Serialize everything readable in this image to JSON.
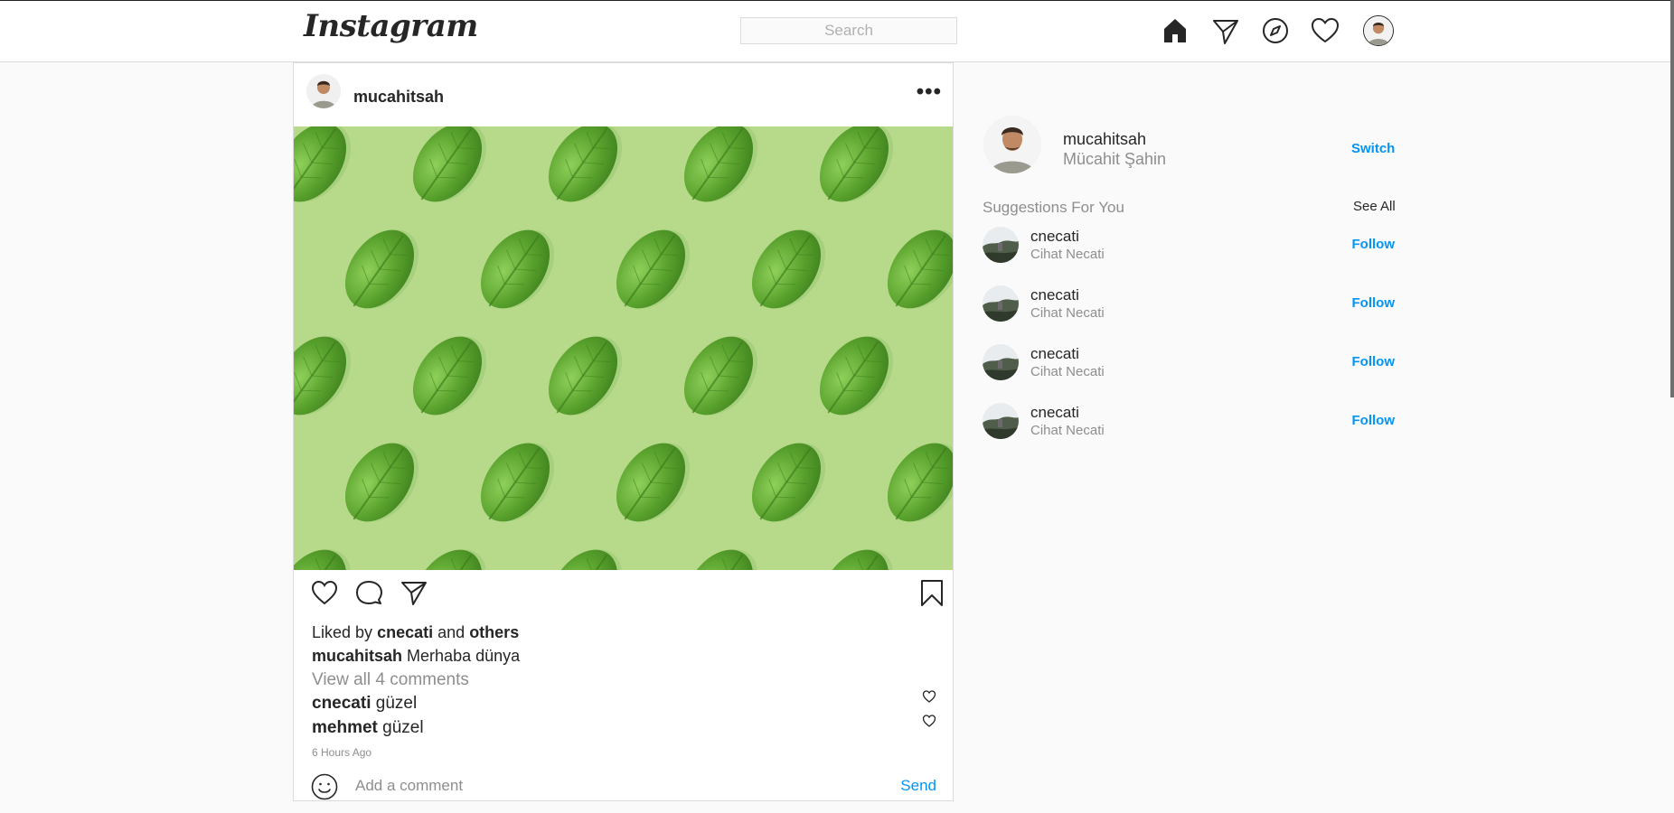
{
  "header": {
    "logo": "Instagram",
    "search_placeholder": "Search",
    "nav_icons": [
      "home-icon",
      "direct-icon",
      "explore-icon",
      "activity-heart-icon",
      "profile-avatar"
    ]
  },
  "post": {
    "username": "mucahitsah",
    "more": "•••",
    "liked_by_prefix": "Liked by",
    "liked_by_user": "cnecati",
    "liked_by_and": "and",
    "liked_by_others": "others",
    "caption_user": "mucahitsah",
    "caption_text": "Merhaba dünya",
    "view_all_comments": "View all 4 comments",
    "comments": [
      {
        "user": "cnecati",
        "text": "güzel"
      },
      {
        "user": "mehmet",
        "text": "güzel"
      }
    ],
    "time": "6 Hours Ago",
    "add_comment_placeholder": "Add a comment",
    "send_label": "Send"
  },
  "sidebar": {
    "username": "mucahitsah",
    "full_name": "Mücahit Şahin",
    "switch_label": "Switch",
    "suggestions_title": "Suggestions For You",
    "see_all_label": "See All",
    "suggestions": [
      {
        "username": "cnecati",
        "name": "Cihat Necati",
        "action": "Follow"
      },
      {
        "username": "cnecati",
        "name": "Cihat Necati",
        "action": "Follow"
      },
      {
        "username": "cnecati",
        "name": "Cihat Necati",
        "action": "Follow"
      },
      {
        "username": "cnecati",
        "name": "Cihat Necati",
        "action": "Follow"
      }
    ]
  },
  "colors": {
    "accent": "#0095f6",
    "muted": "#8e8e8e",
    "post_image_bg": "#b6d98a",
    "leaf": "#5aa32e"
  }
}
